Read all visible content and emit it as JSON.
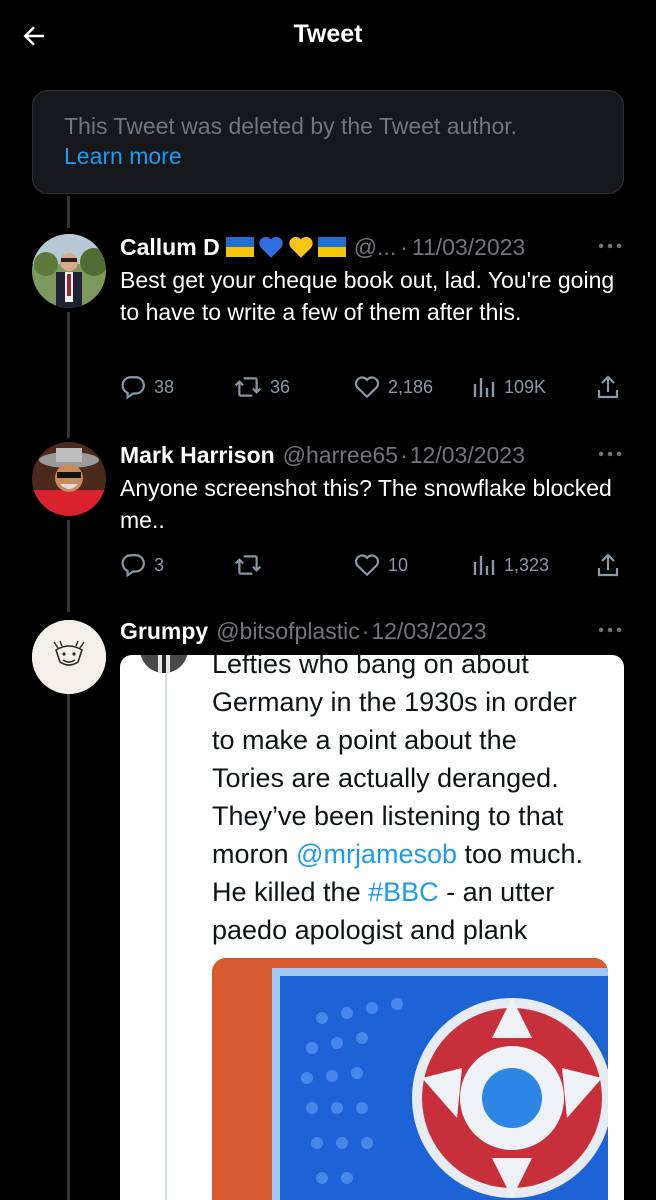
{
  "header": {
    "title": "Tweet"
  },
  "deleted_notice": {
    "text": "This Tweet was deleted by the Tweet author.",
    "link": "Learn more"
  },
  "tweets": [
    {
      "name": "Callum D 🇺🇦💙💛🇺🇦",
      "name_text": "Callum D",
      "handle": "@...",
      "date": "11/03/2023",
      "text": "Best get your cheque book out, lad. You're going to have to write a few of them after this.",
      "replies": "38",
      "retweets": "36",
      "likes": "2,186",
      "views": "109K"
    },
    {
      "name": "Mark Harrison",
      "handle": "@harree65",
      "date": "12/03/2023",
      "text": "Anyone screenshot this? The snowflake blocked me..",
      "replies": "3",
      "retweets": "",
      "likes": "10",
      "views": "1,323"
    },
    {
      "name": "Grumpy",
      "handle": "@bitsofplastic",
      "date": "12/03/2023",
      "embedded": {
        "line1": "Lefties who bang on about",
        "line2": "Germany in the 1930s in order",
        "line3": "to make a point about the",
        "line4": "Tories are actually deranged.",
        "line5": "They’ve been listening to that",
        "line6_pre": "moron ",
        "mention": "@mrjamesob",
        "line6_post": " too much.",
        "line7_pre": "He killed the ",
        "hashtag": "#BBC",
        "line7_post": " - an utter",
        "line8": "paedo apologist and plank"
      }
    }
  ],
  "separator": "·",
  "colors": {
    "background": "#000000",
    "accent": "#1d9bf0",
    "muted": "#71767b",
    "thread_line": "#333639"
  },
  "icons": [
    "back-arrow-icon",
    "more-icon",
    "reply-icon",
    "retweet-icon",
    "like-icon",
    "views-icon",
    "share-icon",
    "ukraine-flag-icon",
    "blue-heart-icon",
    "yellow-heart-icon"
  ]
}
